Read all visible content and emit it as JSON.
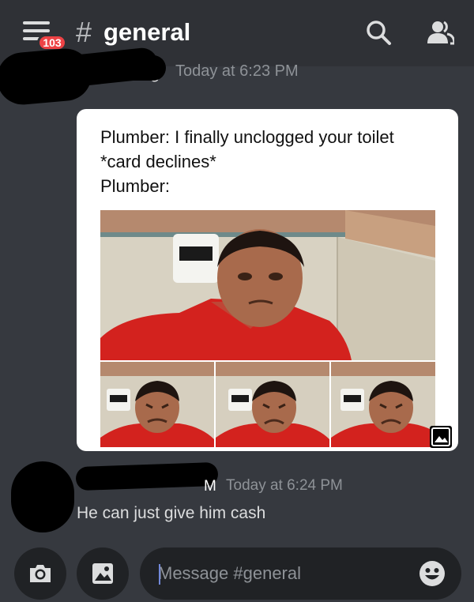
{
  "header": {
    "menu_icon": "hamburger-menu-icon",
    "unread_badge": "103",
    "channel_prefix": "#",
    "channel_name": "general",
    "search_icon": "search-icon",
    "members_icon": "members-icon"
  },
  "messages": [
    {
      "author_fragment": "g",
      "timestamp": "Today at 6:23 PM",
      "embed": {
        "meme_text": "Plumber: I finally unclogged your toilet\n*card declines*\nPlumber:",
        "open_image_icon": "image-icon"
      }
    },
    {
      "author_fragment": "M",
      "timestamp": "Today at 6:24 PM",
      "text": "He can just give him cash"
    }
  ],
  "composer": {
    "camera_icon": "camera-icon",
    "gallery_icon": "gallery-icon",
    "placeholder": "Message #general",
    "emoji_icon": "emoji-icon"
  },
  "colors": {
    "background": "#36393f",
    "header_background": "#2f3136",
    "input_background": "#202225",
    "badge_red": "#ed4245",
    "caret_blurple": "#7289da"
  }
}
